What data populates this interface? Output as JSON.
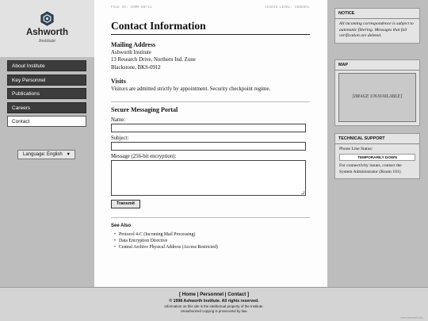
{
  "sidebar": {
    "logo": {
      "name": "Ashworth",
      "subtitle": "Institute"
    },
    "nav": [
      {
        "label": "About Institute",
        "active": false
      },
      {
        "label": "Key Personnel",
        "active": false
      },
      {
        "label": "Publications",
        "active": false
      },
      {
        "label": "Careers",
        "active": false
      },
      {
        "label": "Contact",
        "active": true
      }
    ],
    "language": {
      "label": "Language: English",
      "arrow": "▼"
    }
  },
  "topbar": {
    "left": "FILE ID: COMM-08/11",
    "right": "ACCESS LEVEL: GENERAL"
  },
  "main": {
    "title": "Contact Information",
    "mailing": {
      "heading": "Mailing Address",
      "lines": [
        "Ashworth Institute",
        "13 Research Drive, Northern Ind. Zone",
        "Blackstone, BKS-0912"
      ]
    },
    "visits": {
      "heading": "Visits",
      "text": "Visitors are admitted strictly by appointment. Security checkpoint regime."
    },
    "portal": {
      "heading": "Secure Messaging Portal",
      "name_label": "Name:",
      "subject_label": "Subject:",
      "message_label": "Message (256-bit encryption):",
      "submit_label": "Transmit"
    },
    "see_also": {
      "heading": "See Also",
      "items": [
        "Protocol 4-C (Incoming Mail Processing)",
        "Data Encryption Directive",
        "Central Archive Physical Address (Access Restricted)"
      ]
    }
  },
  "right": {
    "notice": {
      "heading": "NOTICE",
      "text": "All incoming correspondence is subject to automatic filtering. Messages that fail verification are deleted."
    },
    "map": {
      "heading": "MAP",
      "placeholder": "[IMAGE UNAVAILABLE]"
    },
    "support": {
      "heading": "TECHNICAL SUPPORT",
      "status_label": "Phone Line Status:",
      "status_value": "TEMPORARILY DOWN",
      "text": "For connectivity issues, contact the System Administrator (Room 101)."
    }
  },
  "footer": {
    "links": [
      "Home",
      "Personnel",
      "Contact"
    ],
    "copyright": "© 1998 Ashworth Institute. All rights reserved.",
    "legal_1": "Information on this site is the intellectual property of the Institute.",
    "legal_2": "Unauthorized copying is prosecuted by law.",
    "watermark": "www.ashworth.edu"
  },
  "colors": {
    "nav_bg": "#3c3c3c",
    "sidebar_bg": "#bdbdbd",
    "content_bg": "#fdfdfd"
  }
}
